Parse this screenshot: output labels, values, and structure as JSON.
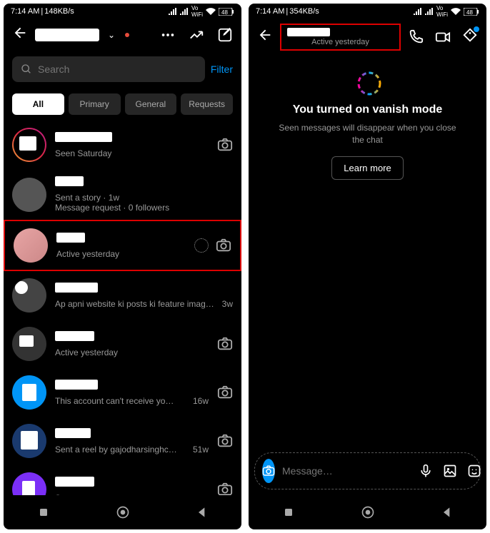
{
  "statusBar": {
    "time": "7:14 AM",
    "speed_left": "148KB/s",
    "speed_right": "354KB/s",
    "battery": "48"
  },
  "leftPhone": {
    "search": {
      "placeholder": "Search"
    },
    "filterLabel": "Filter",
    "tabs": {
      "all": "All",
      "primary": "Primary",
      "general": "General",
      "requests": "Requests"
    },
    "chats": [
      {
        "sub": "Seen Saturday"
      },
      {
        "sub": "Sent a story · 1w",
        "sub2": "Message request · 0 followers"
      },
      {
        "sub": "Active yesterday"
      },
      {
        "sub": "Ap apni website ki posts ki feature imag…",
        "time": "3w"
      },
      {
        "sub": "Active yesterday"
      },
      {
        "sub": "This account can't receive yo…",
        "time": "16w"
      },
      {
        "sub": "Sent a reel by gajodharsinghc…",
        "time": "51w"
      },
      {
        "sub": "Sent"
      }
    ]
  },
  "rightPhone": {
    "userStatus": "Active yesterday",
    "vanish": {
      "title": "You turned on vanish mode",
      "desc": "Seen messages will disappear when you close the chat",
      "learn": "Learn more"
    },
    "msgPlaceholder": "Message…"
  }
}
